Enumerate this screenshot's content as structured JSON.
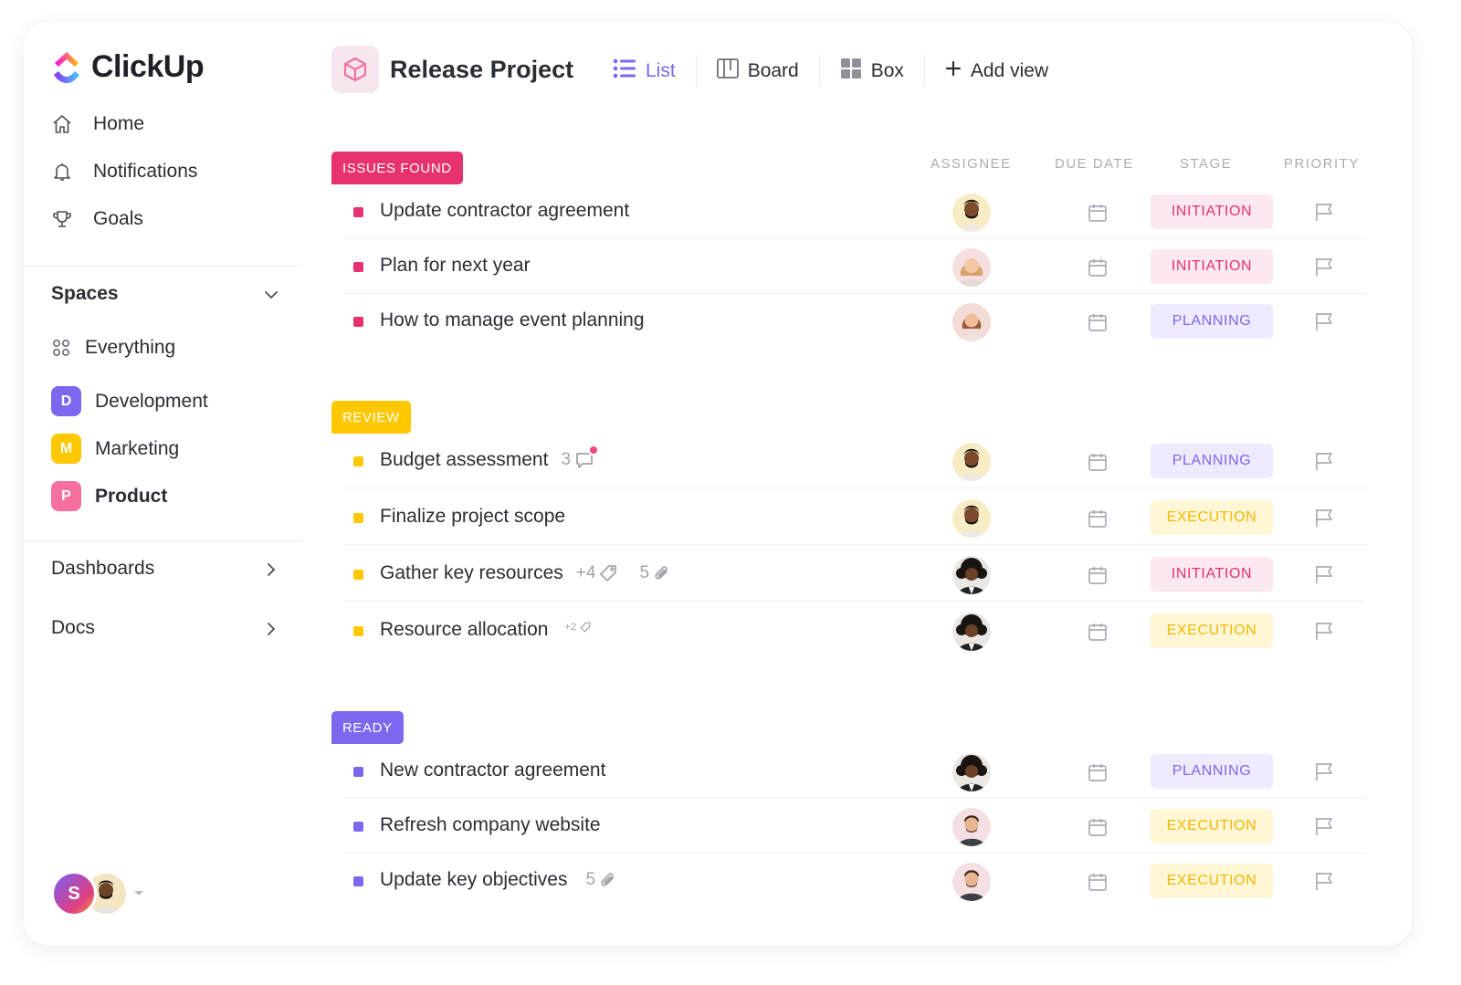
{
  "brand": {
    "name": "ClickUp"
  },
  "nav": [
    {
      "label": "Home",
      "icon": "home-icon"
    },
    {
      "label": "Notifications",
      "icon": "bell-icon"
    },
    {
      "label": "Goals",
      "icon": "trophy-icon"
    }
  ],
  "spaces": {
    "title": "Spaces",
    "everything_label": "Everything",
    "items": [
      {
        "letter": "D",
        "label": "Development",
        "color": "#7b68ee"
      },
      {
        "letter": "M",
        "label": "Marketing",
        "color": "#ffc800"
      },
      {
        "letter": "P",
        "label": "Product",
        "color": "#f56fa1"
      }
    ]
  },
  "sections": [
    {
      "label": "Dashboards"
    },
    {
      "label": "Docs"
    }
  ],
  "user": {
    "initial": "S"
  },
  "header": {
    "title": "Release Project"
  },
  "views": [
    {
      "label": "List",
      "icon": "list-icon",
      "active": true
    },
    {
      "label": "Board",
      "icon": "board-icon",
      "active": false
    },
    {
      "label": "Box",
      "icon": "box-grid-icon",
      "active": false
    },
    {
      "label": "Add view",
      "icon": "plus-icon",
      "active": false
    }
  ],
  "columns": {
    "assignee": "ASSIGNEE",
    "due_date": "DUE DATE",
    "stage": "STAGE",
    "priority": "PRIORITY"
  },
  "groups": [
    {
      "label": "ISSUES FOUND",
      "color": "#e6326e",
      "tasks": [
        {
          "name": "Update contractor agreement",
          "stage": "INITIATION"
        },
        {
          "name": "Plan for next year",
          "stage": "INITIATION"
        },
        {
          "name": "How to manage event planning",
          "stage": "PLANNING"
        }
      ]
    },
    {
      "label": "REVIEW",
      "color": "#ffc800",
      "tasks": [
        {
          "name": "Budget assessment",
          "stage": "PLANNING",
          "comments": "3"
        },
        {
          "name": "Finalize project scope",
          "stage": "EXECUTION"
        },
        {
          "name": "Gather key resources",
          "stage": "INITIATION",
          "tags": "+4",
          "attachments": "5"
        },
        {
          "name": "Resource allocation",
          "stage": "EXECUTION",
          "tags_small": "+2"
        }
      ]
    },
    {
      "label": "READY",
      "color": "#7b68ee",
      "tasks": [
        {
          "name": "New contractor agreement",
          "stage": "PLANNING"
        },
        {
          "name": "Refresh company website",
          "stage": "EXECUTION"
        },
        {
          "name": "Update key objectives",
          "stage": "EXECUTION",
          "attachments": "5"
        }
      ]
    }
  ],
  "stage_colors": {
    "INITIATION": {
      "bg": "#fce8f1",
      "fg": "#e6326e"
    },
    "PLANNING": {
      "bg": "#efeafd",
      "fg": "#7b68ee"
    },
    "EXECUTION": {
      "bg": "#fff6d6",
      "fg": "#f2b800"
    }
  }
}
